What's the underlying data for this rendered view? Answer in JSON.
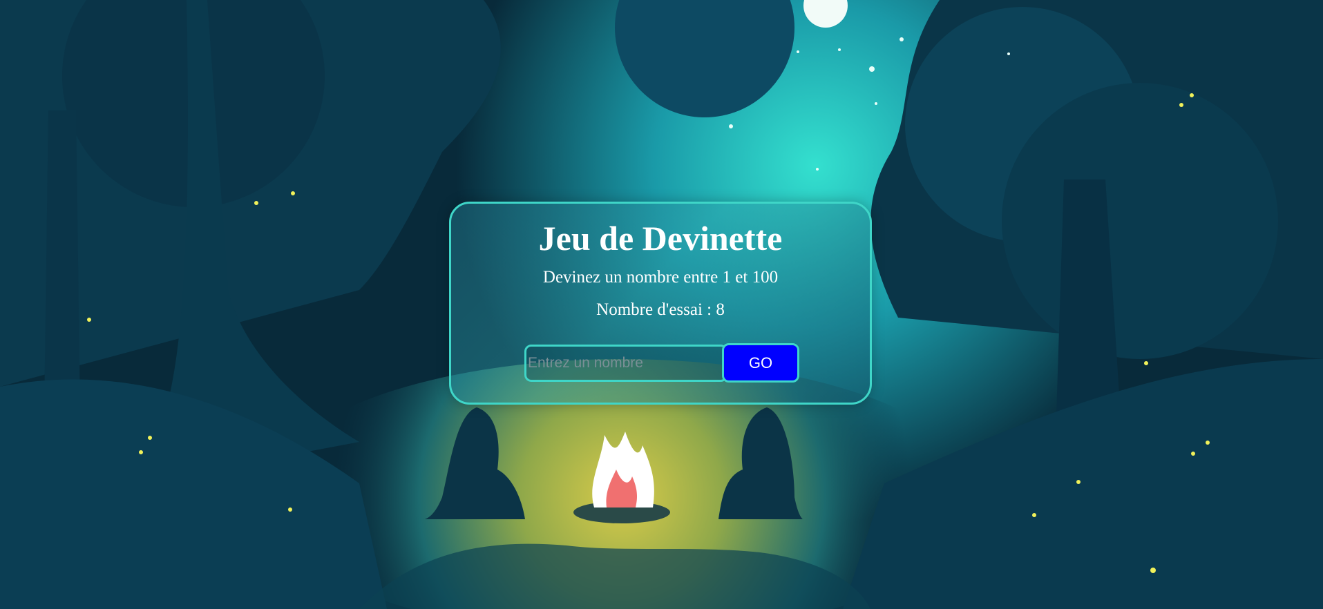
{
  "game": {
    "title": "Jeu de Devinette",
    "instructions": "Devinez un nombre entre 1 et 100",
    "attempts_text": "Nombre d'essai : 8",
    "input_placeholder": "Entrez un nombre",
    "input_value": "",
    "go_label": "GO"
  },
  "colors": {
    "accent_border": "#3fd6c8",
    "button_bg": "#0000ff",
    "text": "#ffffff",
    "background_dark": "#082a3a",
    "moonlight": "#2fd8c8",
    "fire_glow": "#c9c24a"
  }
}
